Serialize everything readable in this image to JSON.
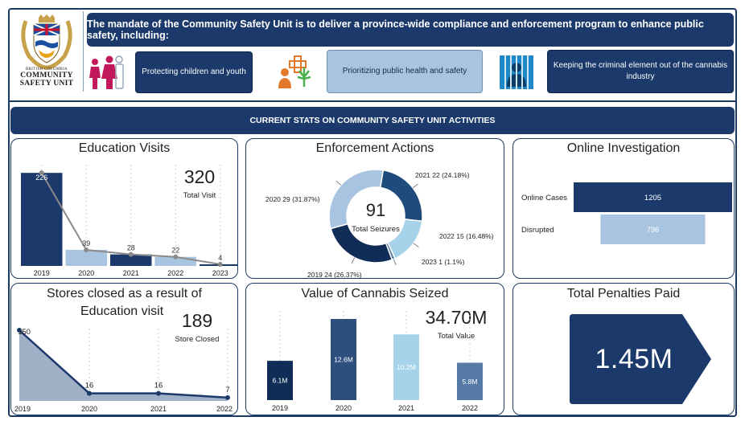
{
  "header": {
    "logo": {
      "line1": "BRITISH COLUMBIA",
      "line2": "COMMUNITY",
      "line3": "SAFETY UNIT"
    },
    "mandate": "The mandate of the Community Safety Unit is to deliver a province-wide compliance and enforcement program to enhance public safety, including:",
    "pillars": [
      {
        "label": "Protecting children and youth",
        "icon": "family-icon"
      },
      {
        "label": "Prioritizing public health and safety",
        "icon": "health-cannabis-icon"
      },
      {
        "label": "Keeping the criminal element out of the cannabis industry",
        "icon": "prison-bars-icon"
      }
    ]
  },
  "banner": "CURRENT STATS ON COMMUNITY SAFETY UNIT ACTIVITIES",
  "colors": {
    "navy": "#1b3a6b",
    "light_blue": "#a9c4e0",
    "mid_blue": "#2e4f7e",
    "sky": "#a7d3ea",
    "steel": "#557aa5"
  },
  "education": {
    "title": "Education Visits",
    "total": "320",
    "total_label": "Total Visit"
  },
  "enforcement": {
    "title": "Enforcement Actions",
    "total": "91",
    "total_label": "Total Seizures",
    "slice_labels": [
      "2021 22 (24.18%)",
      "2022 15 (16.48%)",
      "2023 1 (1.1%)",
      "2019 24 (26.37%)",
      "2020 29 (31.87%)"
    ]
  },
  "online": {
    "title": "Online Investigation"
  },
  "stores": {
    "title_line1": "Stores closed as a result of",
    "title_line2": "Education visit",
    "total": "189",
    "total_label": "Store Closed"
  },
  "cannabis": {
    "title": "Value of Cannabis Seized",
    "total": "34.70M",
    "total_label": "Total Value"
  },
  "penalties": {
    "title": "Total Penalties Paid",
    "value": "1.45M"
  },
  "chart_data": [
    {
      "type": "bar",
      "name": "education",
      "categories": [
        "2019",
        "2020",
        "2021",
        "2022",
        "2023"
      ],
      "values": [
        226,
        39,
        28,
        22,
        4
      ],
      "data_labels": [
        "226",
        "39",
        "28",
        "22",
        "4"
      ],
      "colors": [
        "#1b3a6b",
        "#a9c4e0",
        "#1b3a6b",
        "#a9c4e0",
        "#1b3a6b"
      ],
      "overlay_line": true,
      "ylim": [
        0,
        240
      ]
    },
    {
      "type": "pie",
      "name": "enforcement",
      "donut": true,
      "categories": [
        "2021",
        "2022",
        "2023",
        "2019",
        "2020"
      ],
      "values": [
        22,
        15,
        1,
        24,
        29
      ],
      "percents": [
        24.18,
        16.48,
        1.1,
        26.37,
        31.87
      ],
      "colors": [
        "#1f4a7c",
        "#a7d3ea",
        "#557aa5",
        "#0f2d57",
        "#a9c4e0"
      ]
    },
    {
      "type": "bar",
      "name": "online",
      "orientation": "horizontal",
      "categories": [
        "Online Cases",
        "Disrupted"
      ],
      "values": [
        1205,
        796
      ],
      "data_labels": [
        "1205",
        "796"
      ],
      "colors": [
        "#1b3a6b",
        "#a9c4e0"
      ],
      "xlim": [
        0,
        1205
      ]
    },
    {
      "type": "area",
      "name": "stores",
      "categories": [
        "2019",
        "2020",
        "2021",
        "2022"
      ],
      "values": [
        150,
        16,
        16,
        7
      ],
      "data_labels": [
        "150",
        "16",
        "16",
        "7"
      ],
      "ylim": [
        0,
        150
      ]
    },
    {
      "type": "bar",
      "name": "cannabis",
      "categories": [
        "2019",
        "2020",
        "2021",
        "2022"
      ],
      "values": [
        6.1,
        12.6,
        10.2,
        5.8
      ],
      "data_labels": [
        "6.1M",
        "12.6M",
        "10.2M",
        "5.8M"
      ],
      "colors": [
        "#0f2d57",
        "#2e4f7e",
        "#a7d3ea",
        "#557aa5"
      ],
      "ylim": [
        0,
        12.6
      ]
    }
  ]
}
